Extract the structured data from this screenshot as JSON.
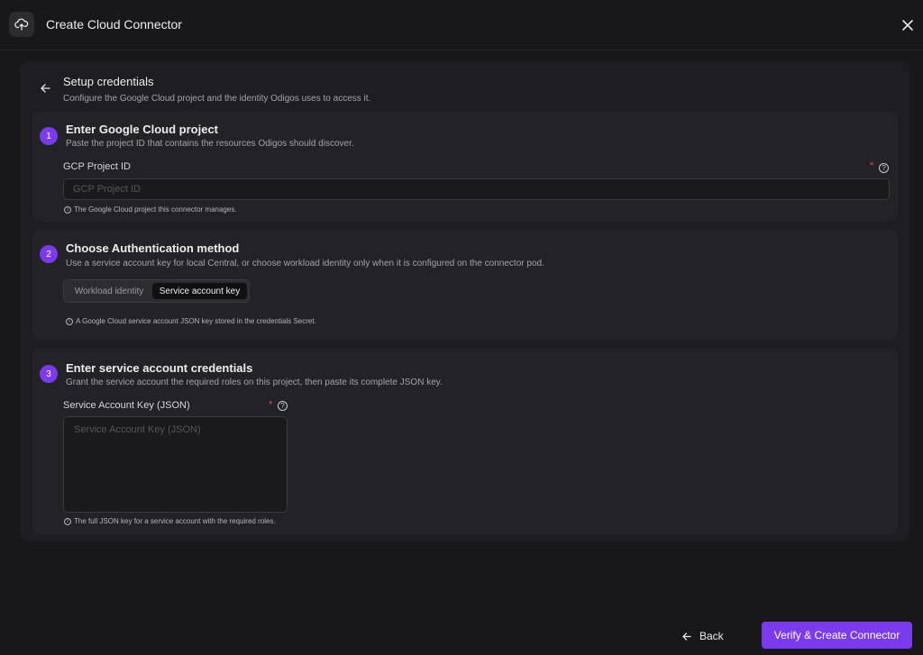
{
  "header": {
    "title": "Create Cloud Connector",
    "app_icon": "cloud-upload-icon",
    "close_icon": "close-icon"
  },
  "setup": {
    "title": "Setup credentials",
    "description": "Configure the Google Cloud project and the identity Odigos uses to access it."
  },
  "steps": [
    {
      "number": "1",
      "title": "Enter Google Cloud project",
      "description": "Paste the project ID that contains the resources Odigos should discover.",
      "field_label": "GCP Project ID",
      "required_mark": "*",
      "placeholder": "GCP Project ID",
      "value": "",
      "hint": "The Google Cloud project this connector manages."
    },
    {
      "number": "2",
      "title": "Choose Authentication method",
      "description": "Use a service account key for local Central, or choose workload identity only when it is configured on the connector pod.",
      "options": [
        "Workload identity",
        "Service account key"
      ],
      "selected": "Service account key",
      "hint": "A Google Cloud service account JSON key stored in the credentials Secret."
    },
    {
      "number": "3",
      "title": "Enter service account credentials",
      "description": "Grant the service account the required roles on this project, then paste its complete JSON key.",
      "field_label": "Service Account Key (JSON)",
      "required_mark": "*",
      "placeholder": "Service Account Key (JSON)",
      "value": "",
      "hint": "The full JSON key for a service account with the required roles."
    }
  ],
  "footer": {
    "back_label": "Back",
    "submit_label": "Verify & Create Connector"
  },
  "colors": {
    "accent": "#7c3aed",
    "background": "#18181b",
    "required": "#ef4444"
  }
}
